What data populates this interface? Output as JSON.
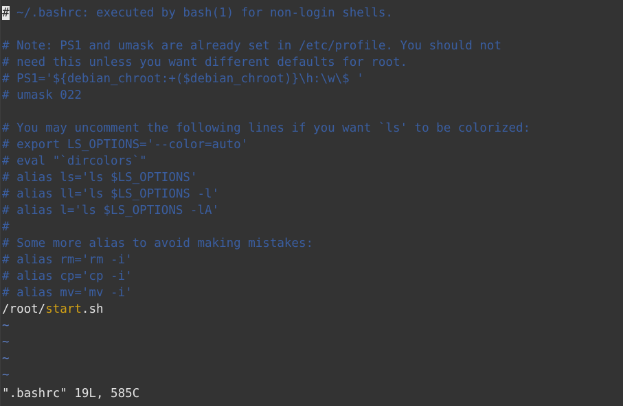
{
  "editor": {
    "app": "vim",
    "filename": ".bashrc",
    "colors": {
      "background": "#333333",
      "comment": "#3a5ea1",
      "normal_text": "#d9d9d9",
      "tilde": "#5d7fc6",
      "highlight_orange": "#d2a115",
      "cursor_block": "#e8e8e8",
      "cursor_glyph": "#2b2b2b",
      "status_text": "#e3e3e3"
    },
    "cursor": {
      "line": 1,
      "column": 1,
      "glyph": "#"
    },
    "lines": [
      {
        "id": "line-1",
        "class": "comment",
        "cursor_char": "#",
        "text": " ~/.bashrc: executed by bash(1) for non-login shells."
      },
      {
        "id": "line-2",
        "class": "comment",
        "text": ""
      },
      {
        "id": "line-3",
        "class": "comment",
        "text": "# Note: PS1 and umask are already set in /etc/profile. You should not"
      },
      {
        "id": "line-4",
        "class": "comment",
        "text": "# need this unless you want different defaults for root."
      },
      {
        "id": "line-5",
        "class": "comment",
        "text": "# PS1='${debian_chroot:+($debian_chroot)}\\h:\\w\\$ '"
      },
      {
        "id": "line-6",
        "class": "comment",
        "text": "# umask 022"
      },
      {
        "id": "line-7",
        "class": "comment",
        "text": ""
      },
      {
        "id": "line-8",
        "class": "comment",
        "text": "# You may uncomment the following lines if you want `ls' to be colorized:"
      },
      {
        "id": "line-9",
        "class": "comment",
        "text": "# export LS_OPTIONS='--color=auto'"
      },
      {
        "id": "line-10",
        "class": "comment",
        "text": "# eval \"`dircolors`\""
      },
      {
        "id": "line-11",
        "class": "comment",
        "text": "# alias ls='ls $LS_OPTIONS'"
      },
      {
        "id": "line-12",
        "class": "comment",
        "text": "# alias ll='ls $LS_OPTIONS -l'"
      },
      {
        "id": "line-13",
        "class": "comment",
        "text": "# alias l='ls $LS_OPTIONS -lA'"
      },
      {
        "id": "line-14",
        "class": "comment",
        "text": "#"
      },
      {
        "id": "line-15",
        "class": "comment",
        "text": "# Some more alias to avoid making mistakes:"
      },
      {
        "id": "line-16",
        "class": "comment",
        "text": "# alias rm='rm -i'"
      },
      {
        "id": "line-17",
        "class": "comment",
        "text": "# alias cp='cp -i'"
      },
      {
        "id": "line-18",
        "class": "comment",
        "text": "# alias mv='mv -i'"
      },
      {
        "id": "line-19",
        "class": "path",
        "path_prefix": "/root/",
        "path_highlight": "start",
        "path_suffix": ".sh"
      }
    ],
    "filler_tildes": [
      "~",
      "~",
      "~",
      "~"
    ],
    "statusline": "\".bashrc\" 19L, 585C",
    "statusline_parts": {
      "file": "\".bashrc\"",
      "lines_count": "19L",
      "chars_count": "585C"
    }
  }
}
